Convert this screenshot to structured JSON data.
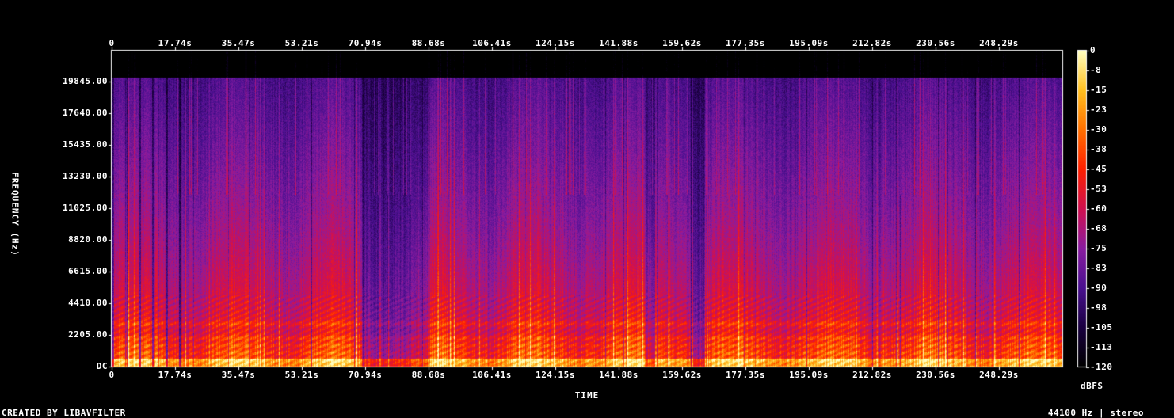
{
  "chart_data": {
    "type": "heatmap",
    "title": "",
    "xlabel": "TIME",
    "ylabel": "FREQUENCY (Hz)",
    "x_ticks": [
      "0",
      "17.74s",
      "35.47s",
      "53.21s",
      "70.94s",
      "88.68s",
      "106.41s",
      "124.15s",
      "141.88s",
      "159.62s",
      "177.35s",
      "195.09s",
      "212.82s",
      "230.56s",
      "248.29s"
    ],
    "y_ticks": [
      "DC",
      "2205.00",
      "4410.00",
      "6615.00",
      "8820.00",
      "11025.00",
      "13230.00",
      "15435.00",
      "17640.00",
      "19845.00"
    ],
    "xlim": [
      0,
      266
    ],
    "ylim": [
      0,
      22050
    ],
    "colorbar": {
      "unit": "dBFS",
      "ticks": [
        "0",
        "-8",
        "-15",
        "-23",
        "-30",
        "-38",
        "-45",
        "-53",
        "-60",
        "-68",
        "-75",
        "-83",
        "-90",
        "-98",
        "-105",
        "-113",
        "-120"
      ],
      "range": [
        -120,
        0
      ]
    },
    "colormap_colors": [
      "#000000",
      "#1a0040",
      "#4a1090",
      "#8a1ca0",
      "#d01050",
      "#ff2000",
      "#ff7000",
      "#ffc020",
      "#ffffc0"
    ],
    "quiet_segments_s": [
      [
        70,
        78
      ],
      [
        78,
        89
      ],
      [
        149,
        152
      ],
      [
        162,
        166
      ]
    ],
    "loud_bands_hz": [
      500,
      1000,
      1500,
      2000,
      3000
    ]
  },
  "footer": {
    "left": "CREATED BY LIBAVFILTER",
    "right": "44100 Hz | stereo"
  }
}
